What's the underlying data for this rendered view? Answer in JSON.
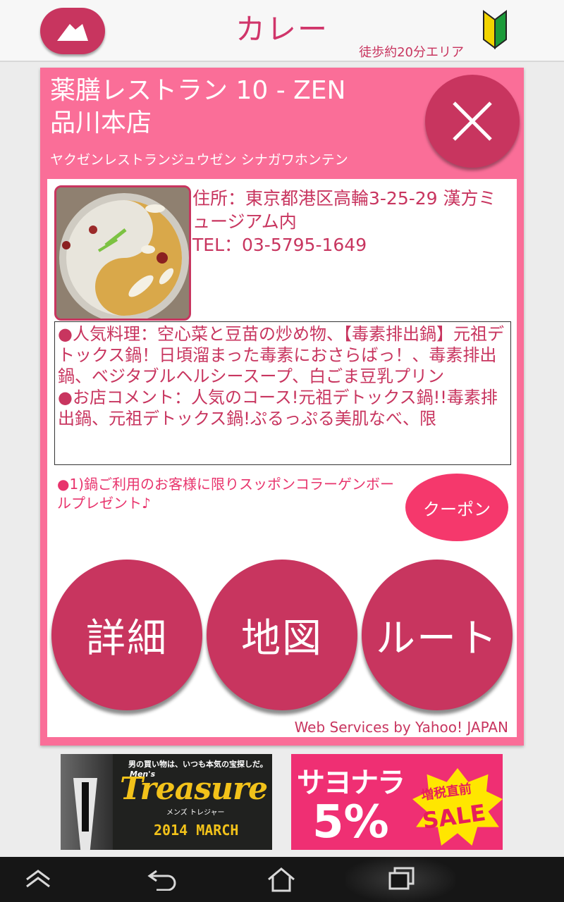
{
  "header": {
    "title": "カレー",
    "area": "徒歩約20分エリア",
    "back_icon": "back-arrow-icon",
    "beginner_icon": "beginner-mark-icon"
  },
  "shop": {
    "name_line1": "薬膳レストラン 10 - ZEN",
    "name_line2": "品川本店",
    "kana": "ヤクゼンレストランジュウゼン シナガワホンテン",
    "address": "住所：東京都港区高輪3-25-29 漢方ミュージアム内",
    "tel": "TEL：03-5795-1649",
    "description": "●人気料理：空心菜と豆苗の炒め物、【毒素排出鍋】元祖デトックス鍋！日頃溜まった毒素におさらばっ！、毒素排出鍋、ベジタブルヘルシースープ、白ごま豆乳プリン\n●お店コメント：人気のコース!元祖デトックス鍋!!毒素排出鍋、元祖デトックス鍋!ぷるっぷる美肌なべ、限",
    "coupon_text": "●1)鍋ご利用のお客様に限りスッポンコラーゲンボールプレゼント♪",
    "coupon_button": "クーポン",
    "credit": "Web Services by Yahoo! JAPAN"
  },
  "actions": {
    "detail": "詳細",
    "map": "地図",
    "route": "ルート"
  },
  "banners": {
    "treasure": {
      "tagline": "男の買い物は、いつも本気の宝探しだ。",
      "mens": "Men's",
      "title": "Treasure",
      "kana": "メンズ トレジャー",
      "date": "2014 MARCH"
    },
    "sale": {
      "title": "サヨナラ",
      "percent": "5%",
      "badge_top": "増税直前",
      "badge_sale": "SALE"
    }
  },
  "colors": {
    "accent": "#c8355f",
    "card": "#fa6e98",
    "title": "#d0356a"
  }
}
